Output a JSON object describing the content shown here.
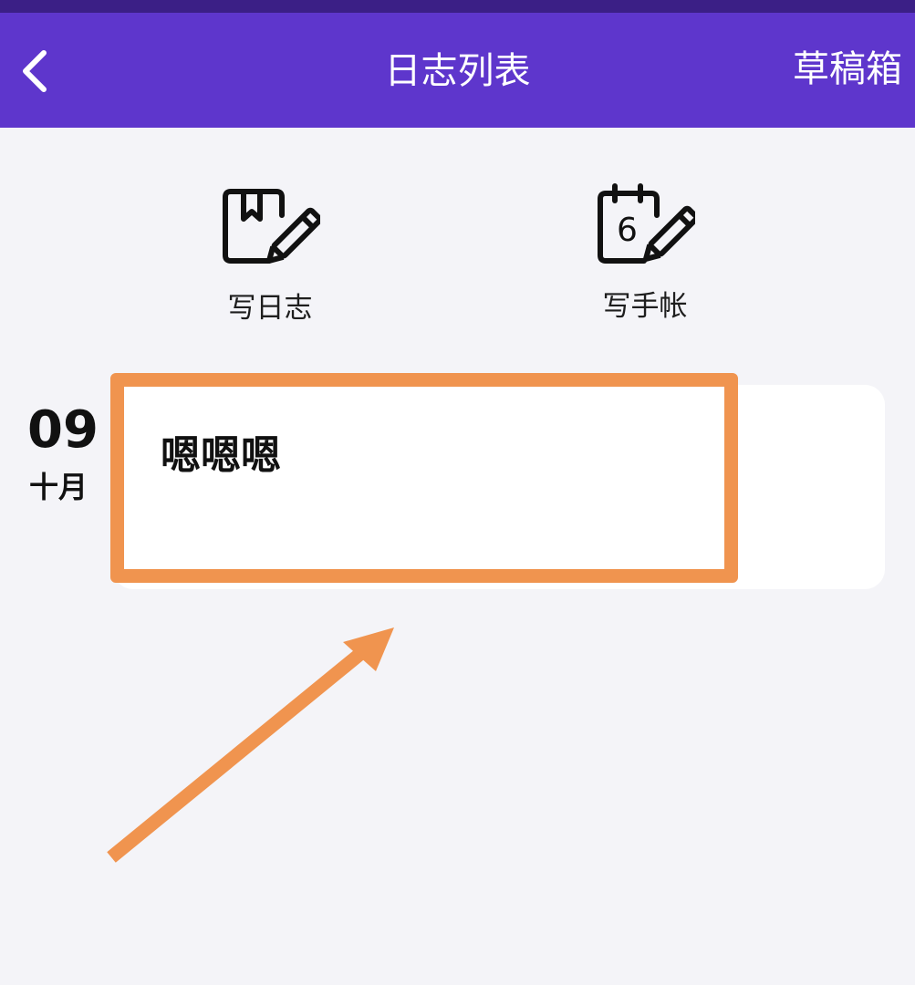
{
  "header": {
    "title": "日志列表",
    "drafts_label": "草稿箱",
    "back_icon": "chevron-left-icon",
    "background": "#5e36cc"
  },
  "actions": [
    {
      "label": "写日志",
      "icon": "journal-pen-icon"
    },
    {
      "label": "写手帐",
      "icon": "calendar-pen-icon",
      "icon_digit": "6"
    }
  ],
  "entries": [
    {
      "day": "09",
      "month": "十月",
      "title": "嗯嗯嗯"
    }
  ],
  "annotation": {
    "color": "#f0944f"
  }
}
